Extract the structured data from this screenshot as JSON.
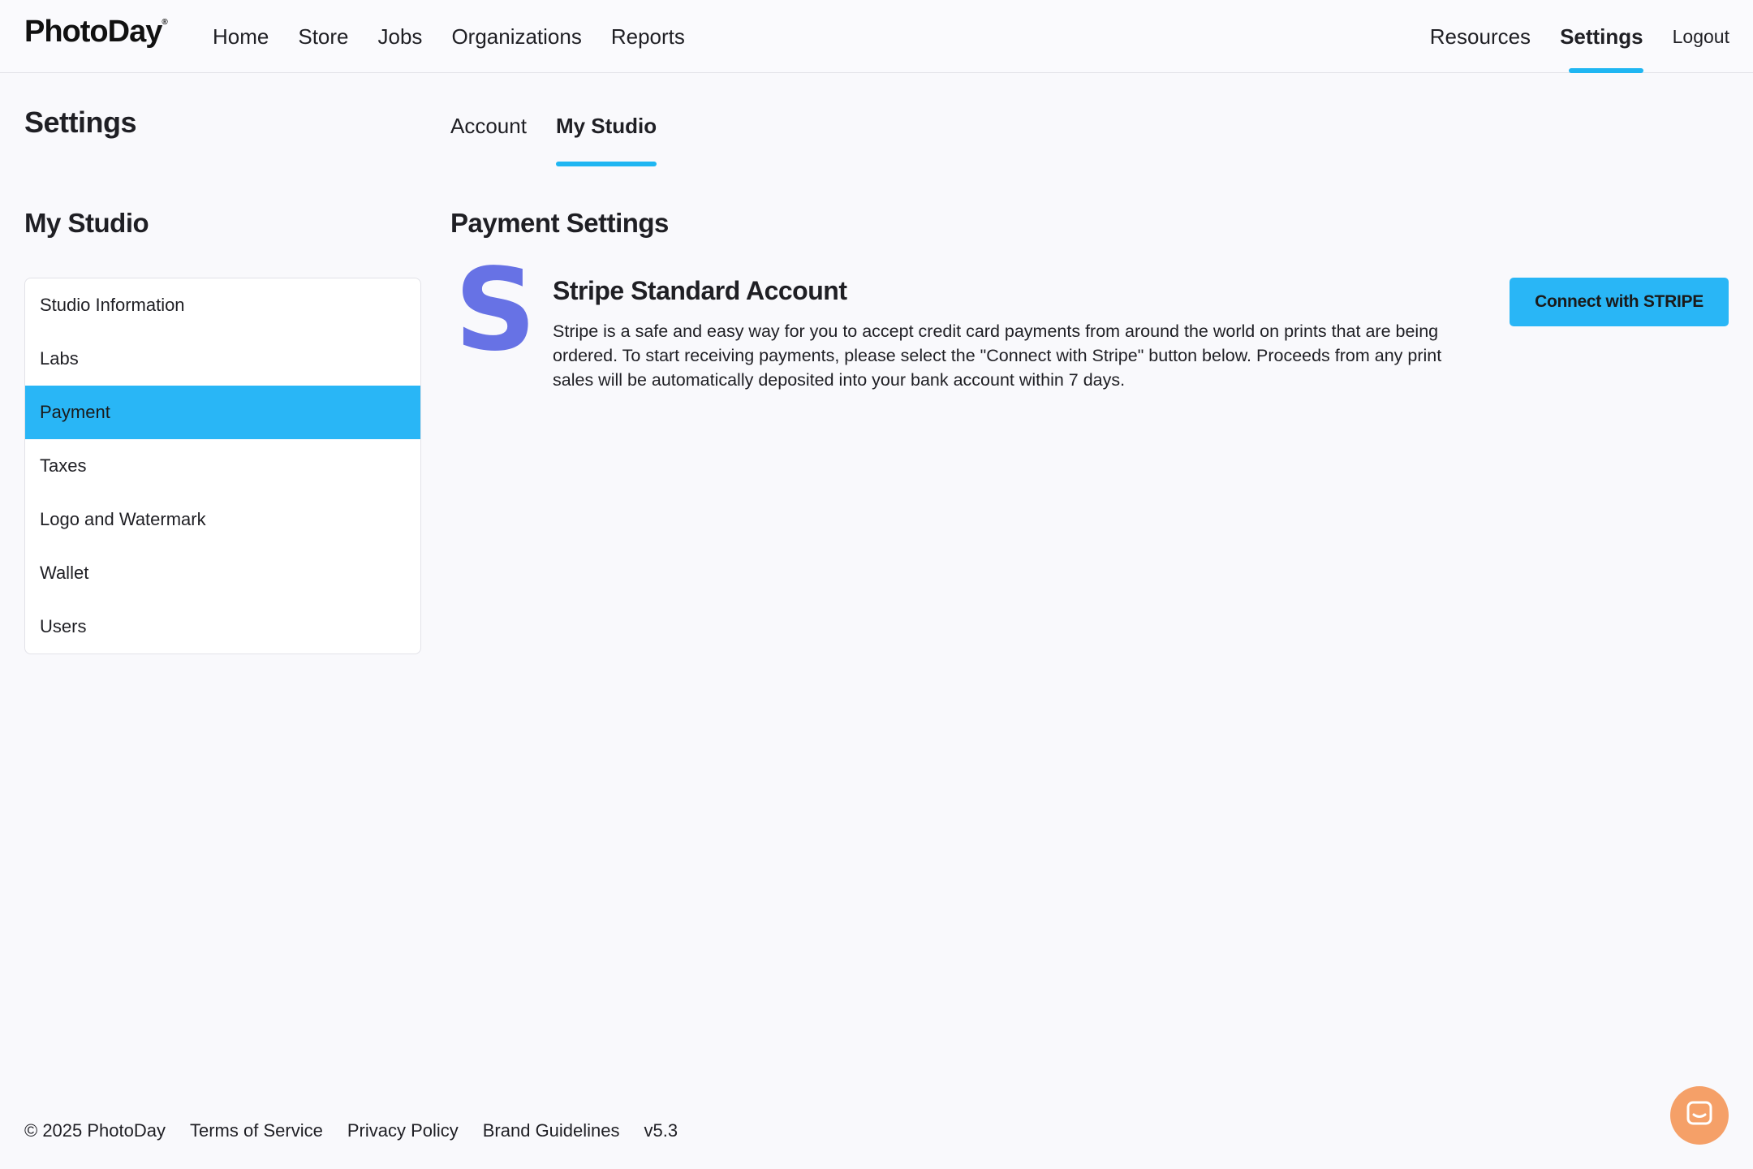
{
  "brand": {
    "name": "PhotoDay",
    "mark": "®"
  },
  "nav": {
    "left": [
      "Home",
      "Store",
      "Jobs",
      "Organizations",
      "Reports"
    ],
    "resources": "Resources",
    "settings": "Settings",
    "logout": "Logout"
  },
  "page": {
    "title": "Settings",
    "tabs": {
      "account": "Account",
      "my_studio": "My Studio"
    }
  },
  "sidebar": {
    "title": "My Studio",
    "items": [
      "Studio Information",
      "Labs",
      "Payment",
      "Taxes",
      "Logo and Watermark",
      "Wallet",
      "Users"
    ],
    "active": "Payment"
  },
  "payment": {
    "title": "Payment Settings",
    "stripe_logo_letter": "S",
    "stripe_title": "Stripe Standard Account",
    "stripe_description": "Stripe is a safe and easy way for you to accept credit card payments from around the world on prints that are being ordered. To start receiving payments, please select the \"Connect with Stripe\" button below. Proceeds from any print sales will be automatically deposited into your bank account within 7 days.",
    "connect_button": "Connect with STRIPE"
  },
  "footer": {
    "copyright": "© 2025 PhotoDay",
    "terms": "Terms of Service",
    "privacy": "Privacy Policy",
    "brand_guidelines": "Brand Guidelines",
    "version": "v5.3"
  },
  "colors": {
    "accent": "#29b6f6",
    "stripe": "#6772e5",
    "chat": "#f5a068"
  },
  "icons": {
    "chat": "chat-icon"
  }
}
